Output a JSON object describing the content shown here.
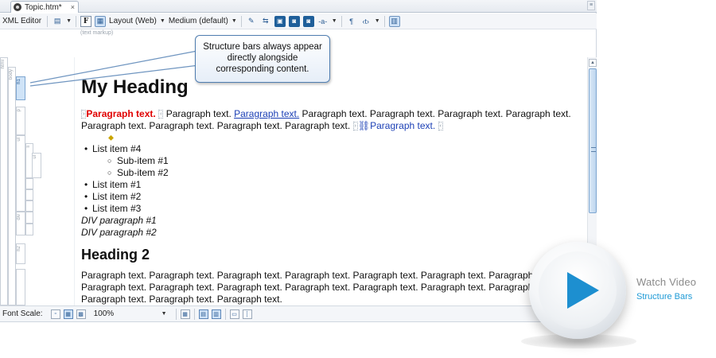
{
  "tab": {
    "title": "Topic.htm*",
    "close": "×"
  },
  "toolbar": {
    "editor_label": "XML Editor",
    "bold_label": "F",
    "layout_label": "Layout (Web)",
    "medium_label": "Medium (default)",
    "pilcrow": "¶",
    "tag_toggle": "‹t›",
    "markup_hint": "(text markup)"
  },
  "structure_bars": {
    "html": "html",
    "body": "body",
    "h1": "h1",
    "p": "p",
    "ul": "ul",
    "li": "li",
    "ul2": "ul",
    "div": "div",
    "h2": "h2"
  },
  "callout": {
    "line1": "Structure bars always appear",
    "line2": "directly alongside",
    "line3": "corresponding content."
  },
  "document": {
    "heading1": "My Heading",
    "para1": {
      "red": "Paragraph text.",
      "t1": " Paragraph text. ",
      "link": "Paragraph text.",
      "t2": " Paragraph text. Paragraph text. Paragraph text. Paragraph text. Paragraph text. Paragraph text. Paragraph text. Paragraph text.",
      "blue": "Paragraph text."
    },
    "list": [
      "List item #4",
      "Sub-item #1",
      "Sub-item #2",
      "List item #1",
      "List item #2",
      "List item #3"
    ],
    "div1": "DIV paragraph #1",
    "div2": "DIV paragraph #2",
    "heading2": "Heading 2",
    "para2": [
      "Paragraph text. Paragraph text. Paragraph text. Paragraph text. Paragraph text. Paragraph text. Paragraph text. Paragraph text.",
      "Paragraph text. Paragraph text. Paragraph text. Paragraph text. Paragraph text. Paragraph text. Paragraph text. Paragraph text.",
      "Paragraph text. Paragraph text. Paragraph text."
    ]
  },
  "statusbar": {
    "font_scale_label": "Font Scale:",
    "zoom": "100%"
  },
  "video": {
    "watch": "Watch Video",
    "title": "Structure Bars"
  },
  "colors": {
    "accent": "#1d8fd0",
    "link": "#1b3fb5",
    "red": "#e00000",
    "video_sub": "#1e9ad6"
  },
  "icons": [
    "document-icon",
    "bold-icon",
    "pilcrow-icon",
    "tag-icon",
    "play-icon"
  ]
}
